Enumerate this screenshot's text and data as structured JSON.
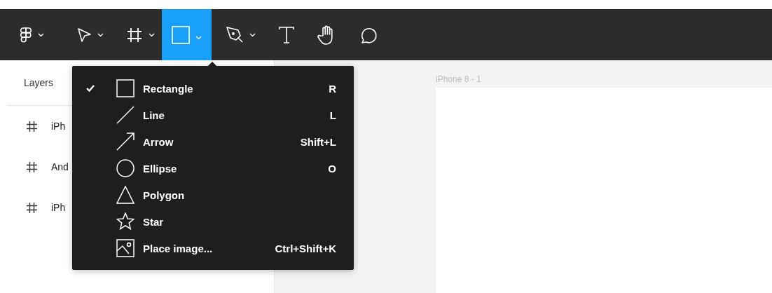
{
  "toolbar": {
    "tools": [
      {
        "kind": "logo",
        "selected": false,
        "dropdown": true
      },
      {
        "kind": "move",
        "selected": false,
        "dropdown": true
      },
      {
        "kind": "frame",
        "selected": false,
        "dropdown": true
      },
      {
        "kind": "shape",
        "selected": true,
        "dropdown": true
      },
      {
        "kind": "pen",
        "selected": false,
        "dropdown": true
      },
      {
        "kind": "text",
        "selected": false,
        "dropdown": false
      },
      {
        "kind": "hand",
        "selected": false,
        "dropdown": false
      },
      {
        "kind": "comment",
        "selected": false,
        "dropdown": false
      }
    ]
  },
  "layers_panel": {
    "title": "Layers",
    "items": [
      {
        "label": "iPh"
      },
      {
        "label": "And"
      },
      {
        "label": "iPh"
      }
    ]
  },
  "canvas": {
    "frame_label": "iPhone 8 - 1"
  },
  "shape_menu": {
    "items": [
      {
        "kind": "rectangle",
        "label": "Rectangle",
        "shortcut": "R",
        "checked": true
      },
      {
        "kind": "line",
        "label": "Line",
        "shortcut": "L",
        "checked": false
      },
      {
        "kind": "arrow",
        "label": "Arrow",
        "shortcut": "Shift+L",
        "checked": false
      },
      {
        "kind": "ellipse",
        "label": "Ellipse",
        "shortcut": "O",
        "checked": false
      },
      {
        "kind": "polygon",
        "label": "Polygon",
        "checked": false
      },
      {
        "kind": "star",
        "label": "Star",
        "checked": false
      },
      {
        "kind": "image",
        "label": "Place image...",
        "shortcut": "Ctrl+Shift+K",
        "checked": false
      }
    ]
  }
}
